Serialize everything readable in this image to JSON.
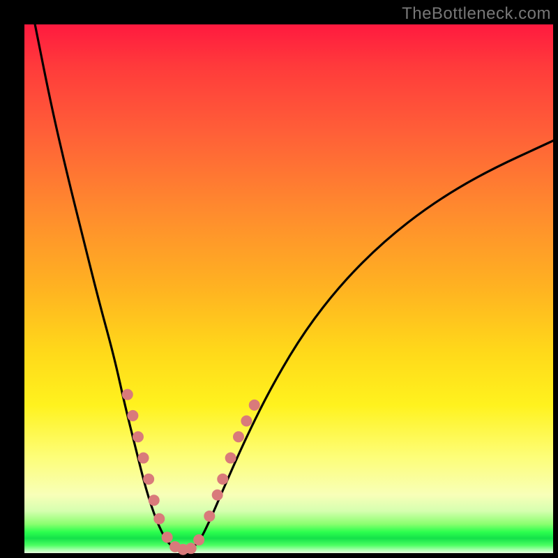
{
  "watermark": "TheBottleneck.com",
  "chart_data": {
    "type": "line",
    "title": "",
    "xlabel": "",
    "ylabel": "",
    "xlim": [
      0,
      100
    ],
    "ylim": [
      0,
      100
    ],
    "background_gradient": {
      "direction": "top-to-bottom",
      "stops": [
        {
          "pct": 0,
          "color": "#ff1a3f"
        },
        {
          "pct": 8,
          "color": "#ff3b3b"
        },
        {
          "pct": 20,
          "color": "#ff5e38"
        },
        {
          "pct": 35,
          "color": "#ff8a2e"
        },
        {
          "pct": 50,
          "color": "#ffb321"
        },
        {
          "pct": 62,
          "color": "#ffd91a"
        },
        {
          "pct": 72,
          "color": "#fff21e"
        },
        {
          "pct": 82,
          "color": "#fdfe7a"
        },
        {
          "pct": 89,
          "color": "#f8ffb8"
        },
        {
          "pct": 92,
          "color": "#d6ffb0"
        },
        {
          "pct": 94.5,
          "color": "#8bff6f"
        },
        {
          "pct": 96,
          "color": "#2cff4e"
        },
        {
          "pct": 97.2,
          "color": "#14e24a"
        },
        {
          "pct": 98.5,
          "color": "#4cff62"
        },
        {
          "pct": 100,
          "color": "#e9ffe0"
        }
      ]
    },
    "series": [
      {
        "name": "bottleneck-curve",
        "stroke": "#000000",
        "points": [
          {
            "x": 2,
            "y": 100
          },
          {
            "x": 5,
            "y": 85
          },
          {
            "x": 8,
            "y": 72
          },
          {
            "x": 11,
            "y": 60
          },
          {
            "x": 14,
            "y": 48
          },
          {
            "x": 17,
            "y": 37
          },
          {
            "x": 19,
            "y": 28
          },
          {
            "x": 21,
            "y": 20
          },
          {
            "x": 23,
            "y": 12
          },
          {
            "x": 25,
            "y": 6
          },
          {
            "x": 27,
            "y": 2
          },
          {
            "x": 29,
            "y": 0.5
          },
          {
            "x": 31,
            "y": 0.5
          },
          {
            "x": 33,
            "y": 2
          },
          {
            "x": 35,
            "y": 6
          },
          {
            "x": 38,
            "y": 13
          },
          {
            "x": 42,
            "y": 22
          },
          {
            "x": 47,
            "y": 32
          },
          {
            "x": 53,
            "y": 42
          },
          {
            "x": 60,
            "y": 51
          },
          {
            "x": 68,
            "y": 59
          },
          {
            "x": 77,
            "y": 66
          },
          {
            "x": 87,
            "y": 72
          },
          {
            "x": 100,
            "y": 78
          }
        ]
      }
    ],
    "markers": {
      "name": "highlight-dots",
      "fill": "#d97a7b",
      "radius": 8,
      "points": [
        {
          "x": 19.5,
          "y": 30
        },
        {
          "x": 20.5,
          "y": 26
        },
        {
          "x": 21.5,
          "y": 22
        },
        {
          "x": 22.5,
          "y": 18
        },
        {
          "x": 23.5,
          "y": 14
        },
        {
          "x": 24.5,
          "y": 10
        },
        {
          "x": 25.5,
          "y": 6.5
        },
        {
          "x": 27.0,
          "y": 3
        },
        {
          "x": 28.5,
          "y": 1.2
        },
        {
          "x": 30.0,
          "y": 0.7
        },
        {
          "x": 31.5,
          "y": 0.9
        },
        {
          "x": 33.0,
          "y": 2.5
        },
        {
          "x": 35.0,
          "y": 7
        },
        {
          "x": 36.5,
          "y": 11
        },
        {
          "x": 37.5,
          "y": 14
        },
        {
          "x": 39.0,
          "y": 18
        },
        {
          "x": 40.5,
          "y": 22
        },
        {
          "x": 42.0,
          "y": 25
        },
        {
          "x": 43.5,
          "y": 28
        }
      ]
    }
  }
}
